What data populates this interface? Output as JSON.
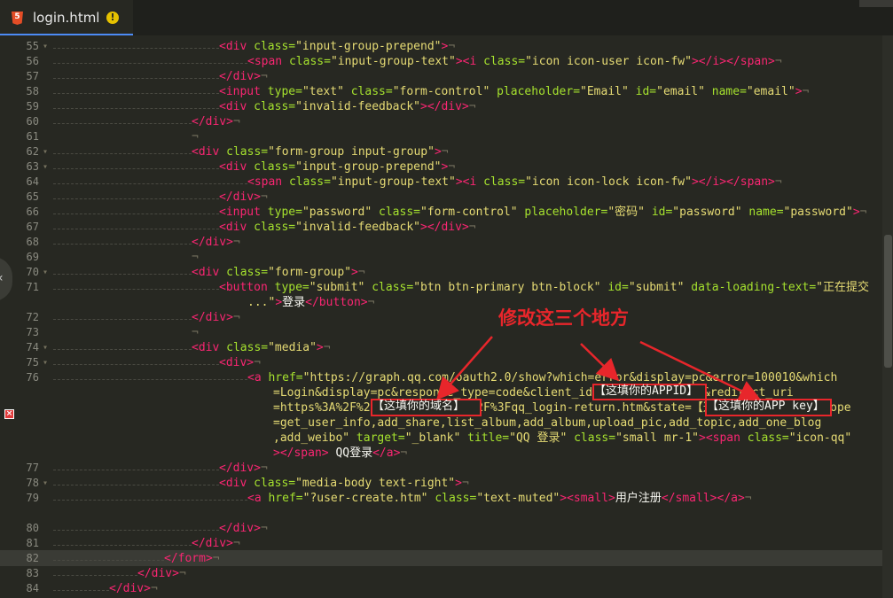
{
  "tab": {
    "filename": "login.html",
    "file_type_icon": "html5-icon",
    "html5_badge": "5",
    "status_icon": "warning-icon",
    "status_symbol": "!"
  },
  "annotation": {
    "title": "修改这三个地方",
    "box_domain": "【这填你的域名】",
    "box_appid": "【这填你的APPID】",
    "box_appkey": "【这填你的APP key】",
    "color": "#e8262b"
  },
  "editor": {
    "highlighted_line": "82",
    "error_marker": "×",
    "collapse_arrow": "‹",
    "lines": [
      {
        "n": "55",
        "segs": [
          [
            "t",
            "<div "
          ],
          [
            "a",
            "class="
          ],
          [
            "s",
            "\"input-group-prepend\""
          ],
          [
            "t",
            ">"
          ],
          [
            "e",
            "¬"
          ]
        ]
      },
      {
        "n": "56",
        "segs": [
          [
            "t",
            "<span "
          ],
          [
            "a",
            "class="
          ],
          [
            "s",
            "\"input-group-text\""
          ],
          [
            "t",
            ">"
          ],
          [
            "t",
            "<i "
          ],
          [
            "a",
            "class="
          ],
          [
            "s",
            "\"icon icon-user icon-fw\""
          ],
          [
            "t",
            ">"
          ],
          [
            "t",
            "</i></span>"
          ],
          [
            "e",
            "¬"
          ]
        ]
      },
      {
        "n": "57",
        "segs": [
          [
            "t",
            "</div>"
          ],
          [
            "e",
            "¬"
          ]
        ]
      },
      {
        "n": "58",
        "segs": [
          [
            "t",
            "<input "
          ],
          [
            "a",
            "type="
          ],
          [
            "s",
            "\"text\" "
          ],
          [
            "a",
            "class="
          ],
          [
            "s",
            "\"form-control\" "
          ],
          [
            "a",
            "placeholder="
          ],
          [
            "s",
            "\"Email\" "
          ],
          [
            "a",
            "id="
          ],
          [
            "s",
            "\"email\" "
          ],
          [
            "a",
            "name="
          ],
          [
            "s",
            "\"email\""
          ],
          [
            "t",
            ">"
          ],
          [
            "e",
            "¬"
          ]
        ]
      },
      {
        "n": "59",
        "segs": [
          [
            "t",
            "<div "
          ],
          [
            "a",
            "class="
          ],
          [
            "s",
            "\"invalid-feedback\""
          ],
          [
            "t",
            ">"
          ],
          [
            "t",
            "</div>"
          ],
          [
            "e",
            "¬"
          ]
        ]
      },
      {
        "n": "60",
        "segs": [
          [
            "t",
            "</div>"
          ],
          [
            "e",
            "¬"
          ]
        ]
      },
      {
        "n": "61",
        "segs": [
          [
            "e",
            "¬"
          ]
        ]
      },
      {
        "n": "62",
        "segs": [
          [
            "t",
            "<div "
          ],
          [
            "a",
            "class="
          ],
          [
            "s",
            "\"form-group input-group\""
          ],
          [
            "t",
            ">"
          ],
          [
            "e",
            "¬"
          ]
        ]
      },
      {
        "n": "63",
        "segs": [
          [
            "t",
            "<div "
          ],
          [
            "a",
            "class="
          ],
          [
            "s",
            "\"input-group-prepend\""
          ],
          [
            "t",
            ">"
          ],
          [
            "e",
            "¬"
          ]
        ]
      },
      {
        "n": "64",
        "segs": [
          [
            "t",
            "<span "
          ],
          [
            "a",
            "class="
          ],
          [
            "s",
            "\"input-group-text\""
          ],
          [
            "t",
            ">"
          ],
          [
            "t",
            "<i "
          ],
          [
            "a",
            "class="
          ],
          [
            "s",
            "\"icon icon-lock icon-fw\""
          ],
          [
            "t",
            ">"
          ],
          [
            "t",
            "</i></span>"
          ],
          [
            "e",
            "¬"
          ]
        ]
      },
      {
        "n": "65",
        "segs": [
          [
            "t",
            "</div>"
          ],
          [
            "e",
            "¬"
          ]
        ]
      },
      {
        "n": "66",
        "segs": [
          [
            "t",
            "<input "
          ],
          [
            "a",
            "type="
          ],
          [
            "s",
            "\"password\" "
          ],
          [
            "a",
            "class="
          ],
          [
            "s",
            "\"form-control\" "
          ],
          [
            "a",
            "placeholder="
          ],
          [
            "s",
            "\"密码\" "
          ],
          [
            "a",
            "id="
          ],
          [
            "s",
            "\"password\" "
          ],
          [
            "a",
            "name="
          ],
          [
            "s",
            "\"password\""
          ],
          [
            "t",
            ">"
          ],
          [
            "e",
            "¬"
          ]
        ]
      },
      {
        "n": "67",
        "segs": [
          [
            "t",
            "<div "
          ],
          [
            "a",
            "class="
          ],
          [
            "s",
            "\"invalid-feedback\""
          ],
          [
            "t",
            ">"
          ],
          [
            "t",
            "</div>"
          ],
          [
            "e",
            "¬"
          ]
        ]
      },
      {
        "n": "68",
        "segs": [
          [
            "t",
            "</div>"
          ],
          [
            "e",
            "¬"
          ]
        ]
      },
      {
        "n": "69",
        "segs": [
          [
            "e",
            "¬"
          ]
        ]
      },
      {
        "n": "70",
        "segs": [
          [
            "t",
            "<div "
          ],
          [
            "a",
            "class="
          ],
          [
            "s",
            "\"form-group\""
          ],
          [
            "t",
            ">"
          ],
          [
            "e",
            "¬"
          ]
        ]
      },
      {
        "n": "71",
        "segs": [
          [
            "t",
            "<button "
          ],
          [
            "a",
            "type="
          ],
          [
            "s",
            "\"submit\" "
          ],
          [
            "a",
            "class="
          ],
          [
            "s",
            "\"btn btn-primary btn-block\" "
          ],
          [
            "a",
            "id="
          ],
          [
            "s",
            "\"submit\" "
          ],
          [
            "a",
            "data-loading-text="
          ],
          [
            "s",
            "\"正在提交"
          ]
        ]
      },
      {
        "n": "",
        "segs": [
          [
            "s",
            "...\""
          ],
          [
            "t",
            ">"
          ],
          [
            "w",
            "登录"
          ],
          [
            "t",
            "</button>"
          ],
          [
            "e",
            "¬"
          ]
        ]
      },
      {
        "n": "72",
        "segs": [
          [
            "t",
            "</div>"
          ],
          [
            "e",
            "¬"
          ]
        ]
      },
      {
        "n": "73",
        "segs": [
          [
            "e",
            "¬"
          ]
        ]
      },
      {
        "n": "74",
        "segs": [
          [
            "t",
            "<div "
          ],
          [
            "a",
            "class="
          ],
          [
            "s",
            "\"media\""
          ],
          [
            "t",
            ">"
          ],
          [
            "e",
            "¬"
          ]
        ]
      },
      {
        "n": "75",
        "segs": [
          [
            "t",
            "<div>"
          ],
          [
            "e",
            "¬"
          ]
        ]
      },
      {
        "n": "76",
        "segs": [
          [
            "t",
            "<a "
          ],
          [
            "a",
            "href="
          ],
          [
            "s",
            "\"https://graph.qq.com/oauth2.0/show?which=error&display=pc&error=100010&which"
          ]
        ]
      },
      {
        "n": "",
        "segs": [
          [
            "s",
            "=Login&display=pc&response_type=code&client_id=【这填你的APPID】&redirect_uri"
          ]
        ]
      },
      {
        "n": "",
        "segs": [
          [
            "s",
            "=https%3A%2F%2F【这填你的域名】%2F%3Fqq_login-return.htm&state=【这填你的APP key】&scope"
          ]
        ]
      },
      {
        "n": "",
        "segs": [
          [
            "s",
            "=get_user_info,add_share,list_album,add_album,upload_pic,add_topic,add_one_blog"
          ]
        ]
      },
      {
        "n": "",
        "segs": [
          [
            "s",
            ",add_weibo\" "
          ],
          [
            "a",
            "target="
          ],
          [
            "s",
            "\"_blank\" "
          ],
          [
            "a",
            "title="
          ],
          [
            "s",
            "\"QQ 登录\" "
          ],
          [
            "a",
            "class="
          ],
          [
            "s",
            "\"small mr-1\""
          ],
          [
            "t",
            ">"
          ],
          [
            "t",
            "<span "
          ],
          [
            "a",
            "class="
          ],
          [
            "s",
            "\"icon-qq\""
          ]
        ]
      },
      {
        "n": "",
        "segs": [
          [
            "t",
            "></span>"
          ],
          [
            "w",
            " QQ登录"
          ],
          [
            "t",
            "</a>"
          ],
          [
            "e",
            "¬"
          ]
        ]
      },
      {
        "n": "77",
        "segs": [
          [
            "t",
            "</div>"
          ],
          [
            "e",
            "¬"
          ]
        ]
      },
      {
        "n": "78",
        "segs": [
          [
            "t",
            "<div "
          ],
          [
            "a",
            "class="
          ],
          [
            "s",
            "\"media-body text-right\""
          ],
          [
            "t",
            ">"
          ],
          [
            "e",
            "¬"
          ]
        ]
      },
      {
        "n": "79",
        "segs": [
          [
            "t",
            "<a "
          ],
          [
            "a",
            "href="
          ],
          [
            "s",
            "\"?user-create.htm\" "
          ],
          [
            "a",
            "class="
          ],
          [
            "s",
            "\"text-muted\""
          ],
          [
            "t",
            ">"
          ],
          [
            "t",
            "<small>"
          ],
          [
            "w",
            "用户注册"
          ],
          [
            "t",
            "</small></a>"
          ],
          [
            "e",
            "¬"
          ]
        ]
      },
      {
        "n": "80",
        "segs": [
          [
            "t",
            "</div>"
          ],
          [
            "e",
            "¬"
          ]
        ]
      },
      {
        "n": "81",
        "segs": [
          [
            "t",
            "</div>"
          ],
          [
            "e",
            "¬"
          ]
        ]
      },
      {
        "n": "82",
        "segs": [
          [
            "t",
            "</form>"
          ],
          [
            "e",
            "¬"
          ]
        ]
      },
      {
        "n": "83",
        "segs": [
          [
            "t",
            "</div>"
          ],
          [
            "e",
            "¬"
          ]
        ]
      },
      {
        "n": "84",
        "segs": [
          [
            "t",
            "</div>"
          ],
          [
            "e",
            "¬"
          ]
        ]
      }
    ]
  }
}
